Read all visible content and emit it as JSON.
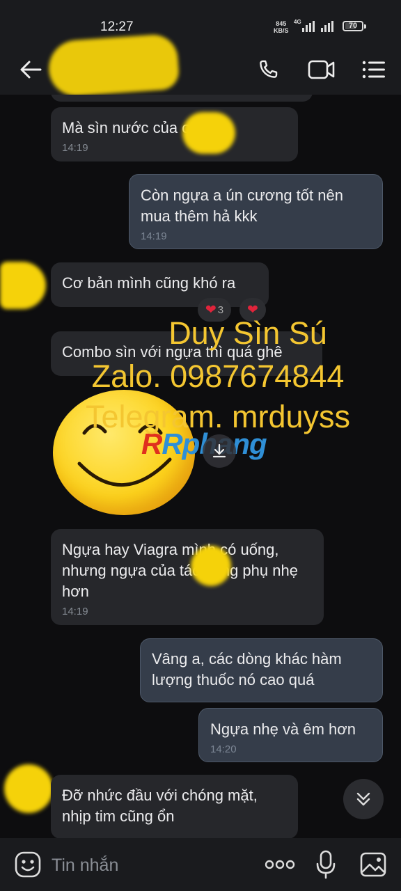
{
  "status_bar": {
    "time": "12:27",
    "speed_value": "845",
    "speed_unit": "KB/S",
    "network": "4G",
    "battery": "70",
    "battery_fraction": 0.7
  },
  "header": {
    "back_icon": "arrow-left-icon",
    "call_icon": "phone-icon",
    "video_icon": "video-camera-icon",
    "menu_icon": "list-menu-icon"
  },
  "messages": [
    {
      "direction": "in",
      "text": "Mà sìn nước của       ok hơn",
      "time": "14:19"
    },
    {
      "direction": "out",
      "text": "Còn ngựa a ún cương tốt nên mua thêm hả kkk",
      "time": "14:19"
    },
    {
      "direction": "in",
      "text": "Cơ bản mình cũng khó ra"
    },
    {
      "direction": "in",
      "text": "Combo sìn với ngựa thì quá ghê"
    },
    {
      "direction": "in",
      "text": "Ngựa hay Viagra mình có uống, nhưng ngựa của      tác dụng phụ nhẹ hơn",
      "time": "14:19"
    },
    {
      "direction": "out",
      "text": "Vâng a, các dòng khác hàm lượng thuốc nó cao quá"
    },
    {
      "direction": "out",
      "text": "Ngựa nhẹ và êm hơn",
      "time": "14:20"
    },
    {
      "direction": "in",
      "text": "Đỡ nhức đầu với chóng mặt, nhịp tim cũng ổn"
    }
  ],
  "reactions": {
    "heart_count": "3",
    "heart_icon": "heart-icon"
  },
  "watermark": {
    "line1": "Duy Sìn Sú",
    "line2": "Zalo. 0987674844",
    "line3": "Telegram. mrduyss",
    "logo": "Rphang",
    "color": "#f4c631"
  },
  "image_message": {
    "download_icon": "download-icon"
  },
  "composer": {
    "placeholder": "Tin nhắn",
    "emoji_icon": "smile-icon",
    "more_icon": "more-dots-icon",
    "mic_icon": "microphone-icon",
    "gallery_icon": "image-icon"
  },
  "scroll_icon": "chevron-double-down-icon",
  "colors": {
    "background": "#0d0d0f",
    "incoming_bubble": "#26272b",
    "outgoing_bubble": "#353d4a",
    "redaction_blur": "#f5d20a"
  }
}
